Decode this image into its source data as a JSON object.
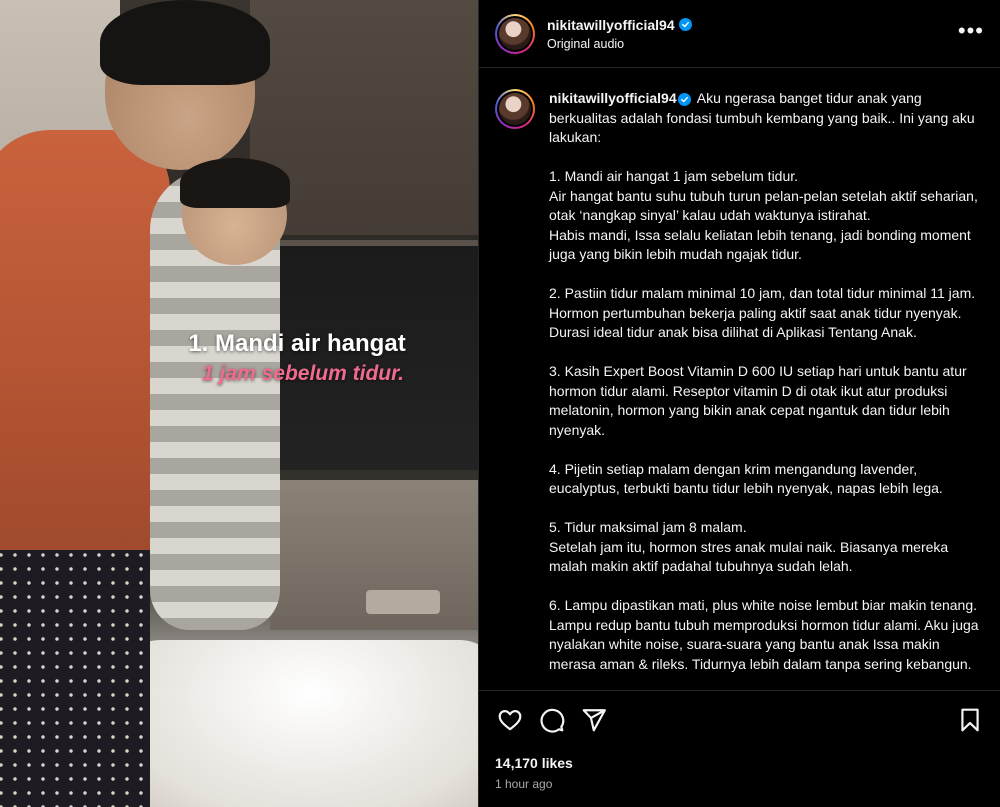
{
  "post": {
    "username": "nikitawillyofficial94",
    "subtitle": "Original audio",
    "more_label": "•••"
  },
  "video_overlay": {
    "line1": "1. Mandi air hangat",
    "line2": "1 jam sebelum tidur."
  },
  "caption": {
    "username": "nikitawillyofficial94",
    "text": "Aku ngerasa banget tidur anak yang berkualitas adalah fondasi tumbuh kembang yang baik.. Ini yang aku lakukan:\n\n1. Mandi air hangat 1 jam sebelum tidur.\nAir hangat bantu suhu tubuh turun pelan-pelan setelah aktif seharian, otak ‘nangkap sinyal’ kalau udah waktunya istirahat.\nHabis mandi, Issa selalu keliatan lebih tenang, jadi bonding moment juga yang bikin lebih mudah ngajak tidur.\n\n2. Pastiin tidur malam minimal 10 jam, dan total tidur minimal 11 jam.\nHormon pertumbuhan bekerja paling aktif saat anak tidur nyenyak. Durasi ideal tidur anak bisa dilihat di Aplikasi Tentang Anak.\n\n3. Kasih Expert Boost Vitamin D 600 IU setiap hari untuk bantu atur hormon tidur alami. Reseptor vitamin D di otak ikut atur produksi melatonin, hormon yang bikin anak cepat ngantuk dan tidur lebih nyenyak.\n\n4. Pijetin setiap malam dengan krim mengandung lavender, eucalyptus, terbukti bantu tidur lebih nyenyak, napas lebih lega.\n\n5. Tidur maksimal jam 8 malam.\nSetelah jam itu, hormon stres anak mulai naik. Biasanya mereka malah makin aktif padahal tubuhnya sudah lelah.\n\n6. Lampu dipastikan mati, plus white noise lembut biar makin tenang.\nLampu redup bantu tubuh memproduksi hormon tidur alami. Aku juga nyalakan white noise, suara-suara yang bantu anak Issa makin merasa aman & rileks. Tidurnya lebih dalam tanpa sering kebangun."
  },
  "actions": {
    "like_icon": "heart-icon",
    "comment_icon": "comment-icon",
    "share_icon": "send-icon",
    "save_icon": "bookmark-icon"
  },
  "stats": {
    "likes": "14,170 likes",
    "time": "1 hour ago"
  },
  "colors": {
    "background": "#000000",
    "text": "#f5f5f5",
    "muted": "#a8a8a8",
    "verified": "#0095f6",
    "overlay_accent": "#f06b8f"
  }
}
